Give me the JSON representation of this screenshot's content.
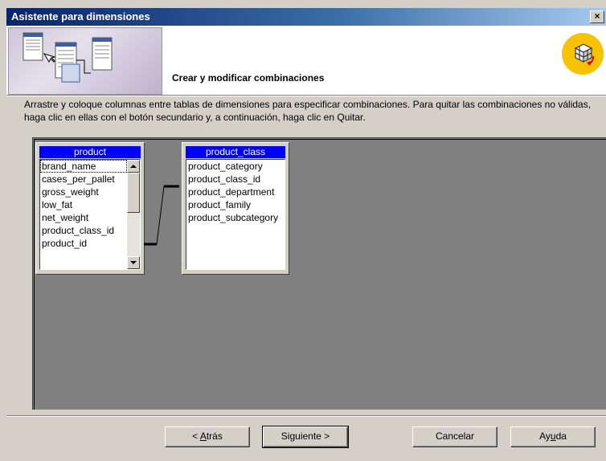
{
  "window": {
    "title": "Asistente para dimensiones",
    "close_glyph": "×"
  },
  "header": {
    "subtitle": "Crear y modificar combinaciones",
    "logo_icon": "cube-wizard-icon"
  },
  "instructions": "Arrastre y coloque columnas entre tablas de dimensiones para especificar combinaciones. Para quitar las combinaciones no válidas, haga clic en ellas con el botón secundario y, a continuación, haga clic en Quitar.",
  "tables": {
    "product": {
      "name": "product",
      "fields": [
        "brand_name",
        "cases_per_pallet",
        "gross_weight",
        "low_fat",
        "net_weight",
        "product_class_id",
        "product_id"
      ]
    },
    "product_class": {
      "name": "product_class",
      "fields": [
        "product_category",
        "product_class_id",
        "product_department",
        "product_family",
        "product_subcategory"
      ]
    }
  },
  "buttons": {
    "back": {
      "prefix": "< ",
      "mnemonic": "A",
      "rest": "trás"
    },
    "next": "Siguiente >",
    "cancel": "Cancelar",
    "help": {
      "prefix": "Ay",
      "mnemonic": "u",
      "rest": "da"
    }
  },
  "colors": {
    "title_bar": "#0a246a",
    "table_header": "#0000ff",
    "canvas": "#808080",
    "dialog": "#d4d0c8"
  }
}
